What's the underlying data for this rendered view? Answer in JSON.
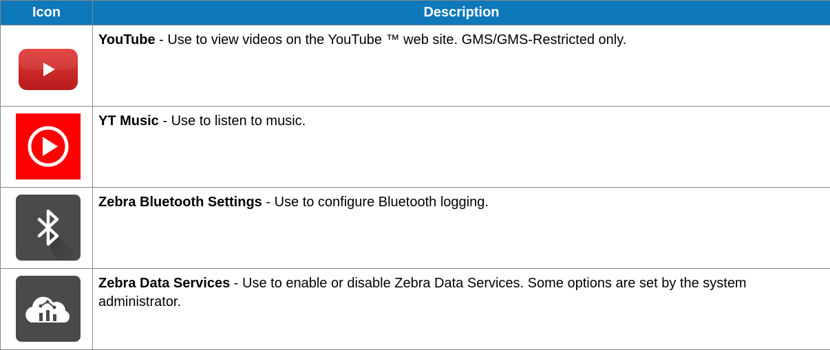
{
  "header": {
    "icon_col": "Icon",
    "desc_col": "Description"
  },
  "rows": [
    {
      "icon": "youtube-icon",
      "name": "YouTube",
      "description": " - Use to view videos on the YouTube ™ web site. GMS/GMS-Restricted only."
    },
    {
      "icon": "yt-music-icon",
      "name": "YT Music",
      "description": " - Use to listen to music."
    },
    {
      "icon": "bluetooth-icon",
      "name": "Zebra Bluetooth Settings",
      "description": " - Use to configure Bluetooth logging."
    },
    {
      "icon": "cloud-analytics-icon",
      "name": "Zebra Data Services",
      "description": " - Use to enable or disable Zebra Data Services. Some options are set by the system administrator."
    }
  ],
  "colors": {
    "header_bg": "#0d78ba",
    "youtube_red": "#d42322",
    "yt_music_red": "#ff0000",
    "zebra_gray": "#4a4a4a"
  }
}
